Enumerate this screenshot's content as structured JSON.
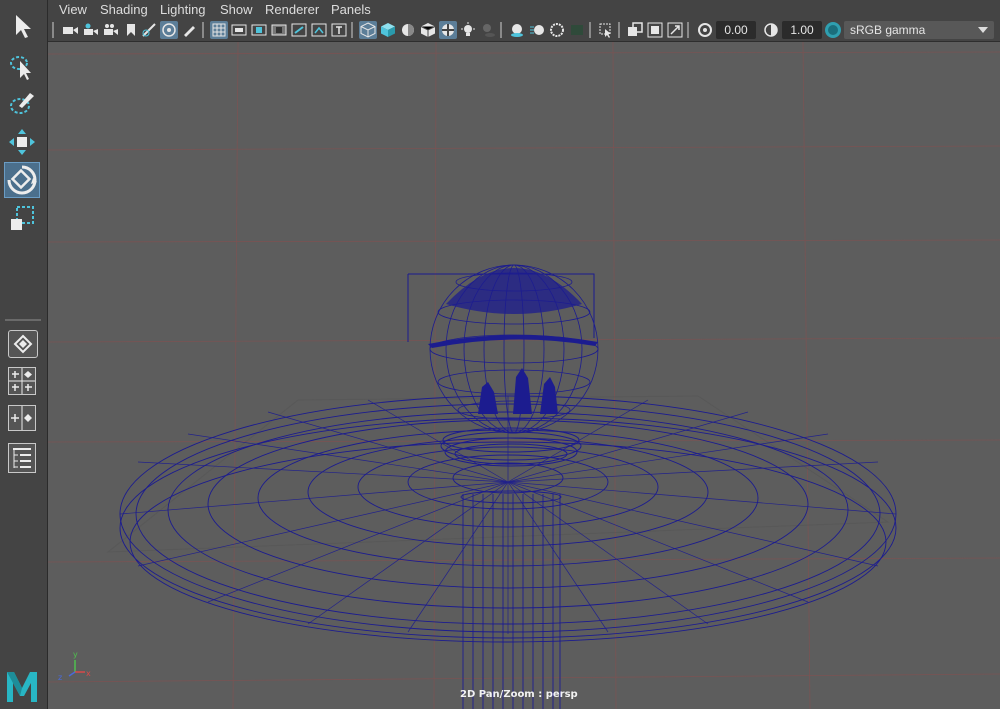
{
  "menubar": {
    "items": [
      "View",
      "Shading",
      "Lighting",
      "Show",
      "Renderer",
      "Panels"
    ]
  },
  "toolbox": {
    "tools": [
      "select-tool",
      "lasso-tool",
      "paint-select-tool",
      "move-tool",
      "rotate-tool",
      "scale-tool"
    ],
    "active_tool": "rotate-tool"
  },
  "iconbar": {
    "exposure": "0.00",
    "gamma": "1.00",
    "color_space": "sRGB gamma"
  },
  "viewport": {
    "camera_label": "2D Pan/Zoom : persp",
    "axis_labels": [
      "y",
      "z",
      "x"
    ],
    "wireframe_color": "#1a1a8c",
    "grid_color": "#8a4a4a"
  }
}
